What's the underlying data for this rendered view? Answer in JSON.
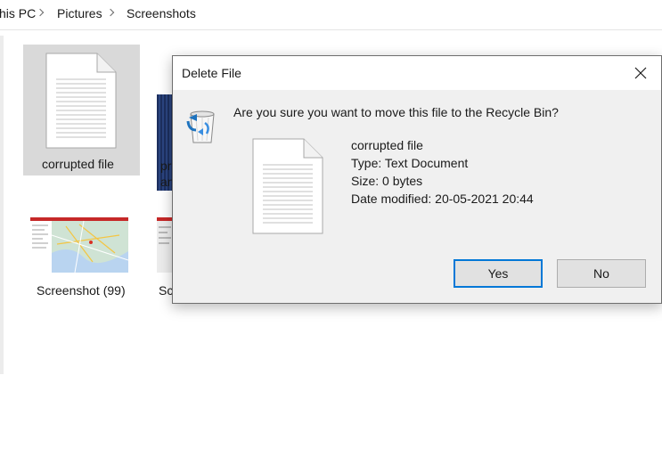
{
  "breadcrumb": [
    "his PC",
    "Pictures",
    "Screenshots"
  ],
  "files": [
    {
      "name": "corrupted file",
      "selected": true
    },
    {
      "name_line1": "pr",
      "name_line2": "an"
    },
    {
      "name": "Screenshot (99)"
    },
    {
      "name": "Sc"
    }
  ],
  "dialog": {
    "title": "Delete File",
    "question": "Are you sure you want to move this file to the Recycle Bin?",
    "file_name": "corrupted file",
    "file_type": "Type: Text Document",
    "file_size": "Size: 0 bytes",
    "file_modified": "Date modified: 20-05-2021 20:44",
    "yes_label": "Yes",
    "no_label": "No",
    "accent_color": "#0078d7"
  },
  "icons": {
    "close": "close-icon",
    "recycle": "recycle-bin-icon",
    "document": "text-document-icon",
    "chevron": "chevron-right-icon"
  }
}
